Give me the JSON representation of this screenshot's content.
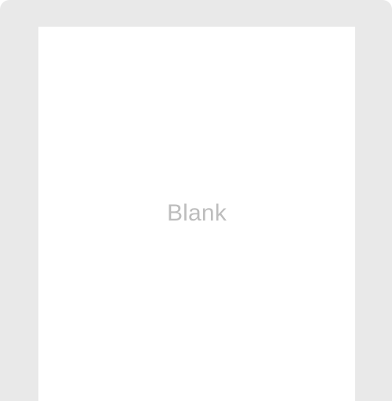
{
  "template": {
    "label": "Blank"
  },
  "colors": {
    "card_background": "#e9e9e9",
    "page_background": "#ffffff",
    "label_text": "#bdbdbd"
  }
}
